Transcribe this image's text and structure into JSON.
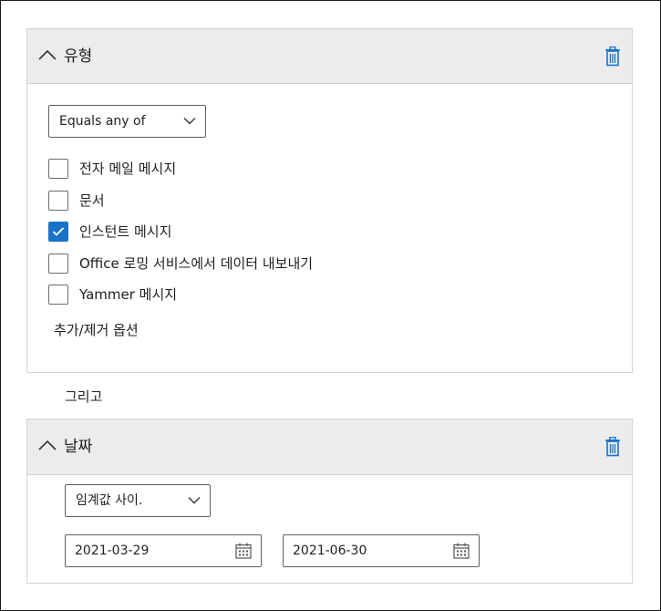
{
  "type_card": {
    "title": "유형",
    "chevron_icon": "chevron-up-icon",
    "delete_icon": "trash-icon",
    "operator_dropdown": "Equals any of",
    "options": [
      {
        "label": "전자 메일 메시지",
        "checked": false
      },
      {
        "label": "문서",
        "checked": false
      },
      {
        "label": "인스턴트 메시지",
        "checked": true
      },
      {
        "label": "Office 로밍 서비스에서 데이터 내보내기",
        "checked": false
      },
      {
        "label": "Yammer 메시지",
        "checked": false
      }
    ],
    "add_remove_link": "추가/제거 옵션"
  },
  "connector": "그리고",
  "date_card": {
    "title": "날짜",
    "chevron_icon": "chevron-up-icon",
    "delete_icon": "trash-icon",
    "operator_dropdown": "임계값 사이.",
    "start_date": "2021-03-29",
    "end_date": "2021-06-30",
    "calendar_icon": "calendar-icon"
  },
  "colors": {
    "accent": "#1a73c8",
    "header_bg": "#ececec",
    "border": "#d2d2d2"
  }
}
